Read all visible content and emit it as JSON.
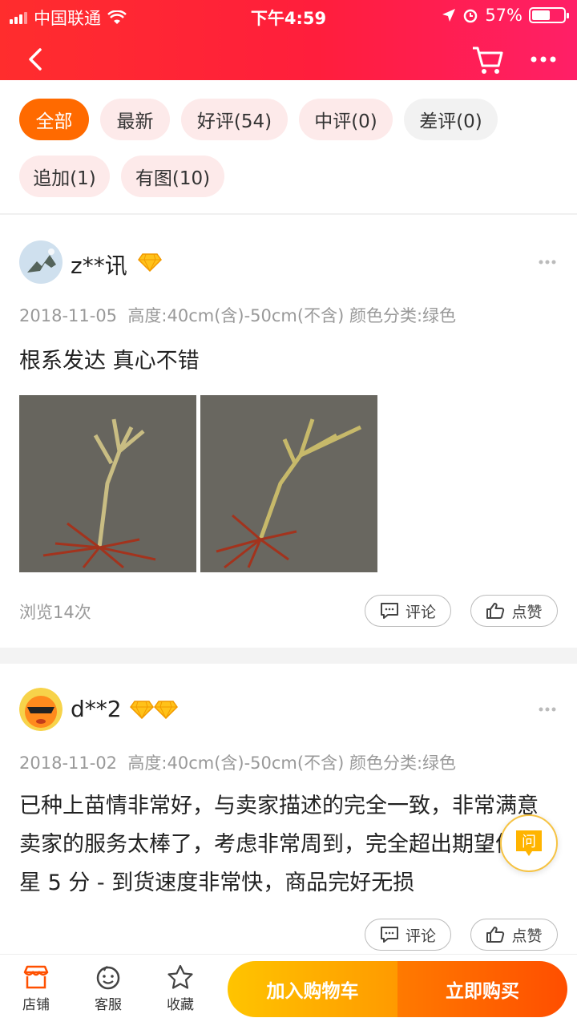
{
  "status_bar": {
    "carrier": "中国联通",
    "time": "下午4:59",
    "battery": "57%",
    "battery_level": 0.57
  },
  "nav": {
    "back_icon": "chevron-left-icon",
    "cart_icon": "cart-icon",
    "more_icon": "more-dots-icon"
  },
  "filters": [
    {
      "label": "全部",
      "active": true
    },
    {
      "label": "最新"
    },
    {
      "label": "好评(54)"
    },
    {
      "label": "中评(0)"
    },
    {
      "label": "差评(0)"
    },
    {
      "label": "追加(1)"
    },
    {
      "label": "有图(10)"
    }
  ],
  "reviews": [
    {
      "user": "z**讯",
      "badges": 1,
      "date": "2018-11-05",
      "spec": "高度:40cm(含)-50cm(不含) 颜色分类:绿色",
      "text": "根系发达 真心不错",
      "views": "浏览14次",
      "comment_label": "评论",
      "like_label": "点赞"
    },
    {
      "user": "d**2",
      "badges": 2,
      "date": "2018-11-02",
      "spec": "高度:40cm(含)-50cm(不含) 颜色分类:绿色",
      "text": "已种上苗情非常好，与卖家描述的完全一致，非常满意 卖家的服务太棒了，考虑非常周到，完全超出期望值 五星 5 分 - 到货速度非常快，商品完好无损",
      "comment_label": "评论",
      "like_label": "点赞"
    }
  ],
  "ask_button": "问",
  "bottom": {
    "tabs": [
      {
        "label": "店铺",
        "icon": "store-icon"
      },
      {
        "label": "客服",
        "icon": "service-icon"
      },
      {
        "label": "收藏",
        "icon": "star-icon"
      }
    ],
    "add_cart": "加入购物车",
    "buy_now": "立即购买"
  },
  "colors": {
    "header": "#ff1e3c",
    "accent": "#ff6a00",
    "add_cart": "#ffb000",
    "buy_now": "#ff5a00"
  }
}
